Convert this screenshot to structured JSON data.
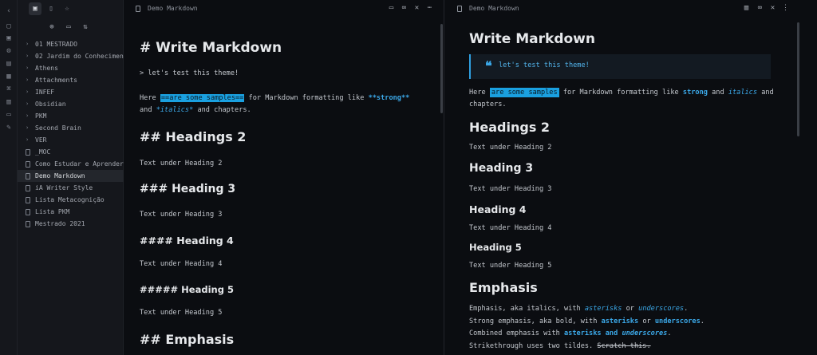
{
  "app": {
    "ribbon_icons": [
      "chevron-left-icon",
      "file-icon",
      "file-search-icon",
      "gear-icon",
      "document-icon",
      "grid-icon",
      "graph-icon",
      "book-icon",
      "pages-icon",
      "paint-icon"
    ]
  },
  "sidebar": {
    "tabs": [
      "file-explorer-icon",
      "search-icon",
      "bookmark-icon"
    ],
    "actions": [
      "new-note-icon",
      "new-folder-icon",
      "sort-icon"
    ],
    "folders": [
      "01 MESTRADO",
      "02 Jardim do Conhecimento",
      "Athens",
      "Attachments",
      "INFEF",
      "Obsidian",
      "PKM",
      "Second Brain",
      "VER"
    ],
    "files": [
      "_MOC",
      "Como Estudar e Aprender",
      "Demo Markdown",
      "iA Writer Style",
      "Lista Metacognição",
      "Lista PKM",
      "Mestrado 2021"
    ],
    "active_file": "Demo Markdown"
  },
  "left_pane": {
    "title": "Demo Markdown",
    "h1": "# Write Markdown",
    "quote": "> let's test this theme!",
    "para1_a": "Here ",
    "para1_hl": "==are some samples==",
    "para1_b": " for Markdown formatting like ",
    "para1_strong": "**strong**",
    "para2_a": "and ",
    "para2_em": "*italics*",
    "para2_b": " and chapters.",
    "h2": "## Headings 2",
    "t2": "Text under Heading 2",
    "h3": "### Heading 3",
    "t3": "Text under Heading 3",
    "h4": "#### Heading 4",
    "t4": "Text under Heading 4",
    "h5": "##### Heading 5",
    "t5": "Text under Heading 5",
    "h_emph": "## Emphasis"
  },
  "right_pane": {
    "title": "Demo Markdown",
    "h1": "Write Markdown",
    "quote": "let's test this theme!",
    "para1_a": "Here ",
    "para1_hl": "are some samples",
    "para1_b": " for Markdown formatting like ",
    "para1_strong": "strong",
    "para1_c": " and ",
    "para1_em": "italics",
    "para1_d": " and",
    "para2": "chapters.",
    "h2": "Headings 2",
    "t2": "Text under Heading 2",
    "h3": "Heading 3",
    "t3": "Text under Heading 3",
    "h4": "Heading 4",
    "t4": "Text under Heading 4",
    "h5": "Heading 5",
    "t5": "Text under Heading 5",
    "h_emph": "Emphasis",
    "e1_a": "Emphasis, aka italics, with ",
    "e1_em1": "asterisks",
    "e1_b": " or ",
    "e1_em2": "underscores",
    "e1_c": ".",
    "e2_a": "Strong emphasis, aka bold, with ",
    "e2_s1": "asterisks",
    "e2_b": " or ",
    "e2_s2": "underscores",
    "e2_c": ".",
    "e3_a": "Combined emphasis with ",
    "e3_s": "asterisks and ",
    "e3_si": "underscores",
    "e3_c": ".",
    "e4_a": "Strikethrough uses two tildes. ",
    "e4_strike": "Scratch this."
  },
  "colors": {
    "accent": "#3ba8e8",
    "highlight": "#1aa0e0",
    "background": "#0b0d11",
    "sidebar": "#15171c"
  }
}
